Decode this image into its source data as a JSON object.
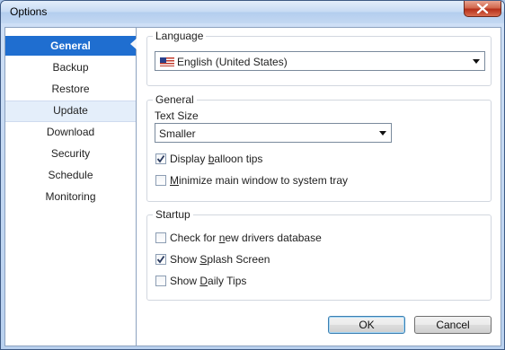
{
  "window": {
    "title": "Options"
  },
  "sidebar": {
    "items": [
      {
        "label": "General",
        "state": "selected"
      },
      {
        "label": "Backup"
      },
      {
        "label": "Restore"
      },
      {
        "label": "Update",
        "state": "hover"
      },
      {
        "label": "Download"
      },
      {
        "label": "Security"
      },
      {
        "label": "Schedule"
      },
      {
        "label": "Monitoring"
      }
    ]
  },
  "language": {
    "legend": "Language",
    "selected": "English (United States)",
    "flag_icon": "us-flag-icon"
  },
  "general": {
    "legend": "General",
    "text_size_label": "Text Size",
    "text_size_value": "Smaller",
    "balloon": {
      "pre": "Display ",
      "accel": "b",
      "post": "alloon tips",
      "checked": true
    },
    "minimize": {
      "pre": "",
      "accel": "M",
      "post": "inimize main window to system tray",
      "checked": false
    }
  },
  "startup": {
    "legend": "Startup",
    "check_new": {
      "pre": "Check for ",
      "accel": "n",
      "post": "ew drivers database",
      "checked": false
    },
    "splash": {
      "pre": "Show ",
      "accel": "S",
      "post": "plash Screen",
      "checked": true
    },
    "daily": {
      "pre": "Show ",
      "accel": "D",
      "post": "aily Tips",
      "checked": false
    }
  },
  "buttons": {
    "ok": "OK",
    "cancel": "Cancel"
  },
  "colors": {
    "accent": "#1f6ed0",
    "close": "#c4452c"
  }
}
